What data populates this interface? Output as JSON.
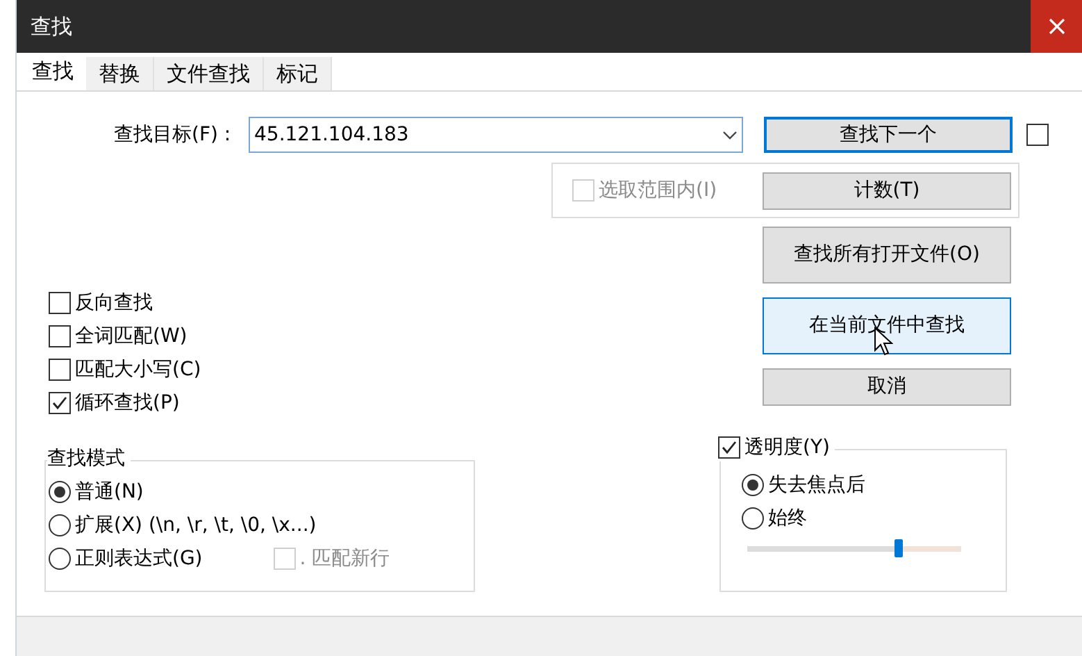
{
  "window": {
    "title": "查找"
  },
  "tabs": [
    {
      "label": "查找",
      "selected": true
    },
    {
      "label": "替换",
      "selected": false
    },
    {
      "label": "文件查找",
      "selected": false
    },
    {
      "label": "标记",
      "selected": false
    }
  ],
  "find": {
    "label": "查找目标(F) :",
    "value": "45.121.104.183"
  },
  "side_checkbox": {
    "checked": false
  },
  "in_selection": {
    "label": "选取范围内(I)",
    "checked": false,
    "disabled": true
  },
  "buttons": [
    {
      "label": "查找下一个",
      "kind": "default"
    },
    {
      "label": "计数(T)",
      "kind": "normal"
    },
    {
      "label": "查找所有打开文件(O)",
      "kind": "normal"
    },
    {
      "label": "在当前文件中查找",
      "kind": "hover"
    },
    {
      "label": "取消",
      "kind": "normal"
    }
  ],
  "options": [
    {
      "label": "反向查找",
      "checked": false
    },
    {
      "label": "全词匹配(W)",
      "checked": false
    },
    {
      "label": "匹配大小写(C)",
      "checked": false
    },
    {
      "label": "循环查找(P)",
      "checked": true
    }
  ],
  "search_mode": {
    "title": "查找模式",
    "options": [
      {
        "label": "普通(N)",
        "selected": true
      },
      {
        "label": "扩展(X) (\\n, \\r, \\t, \\0, \\x...)",
        "selected": false
      },
      {
        "label": "正则表达式(G)",
        "selected": false
      }
    ],
    "dot_newline": {
      "label": ". 匹配新行",
      "checked": false,
      "disabled": true
    }
  },
  "transparency": {
    "label": "透明度(Y)",
    "checked": true,
    "options": [
      {
        "label": "失去焦点后",
        "selected": true
      },
      {
        "label": "始终",
        "selected": false
      }
    ],
    "level": 0.71
  }
}
